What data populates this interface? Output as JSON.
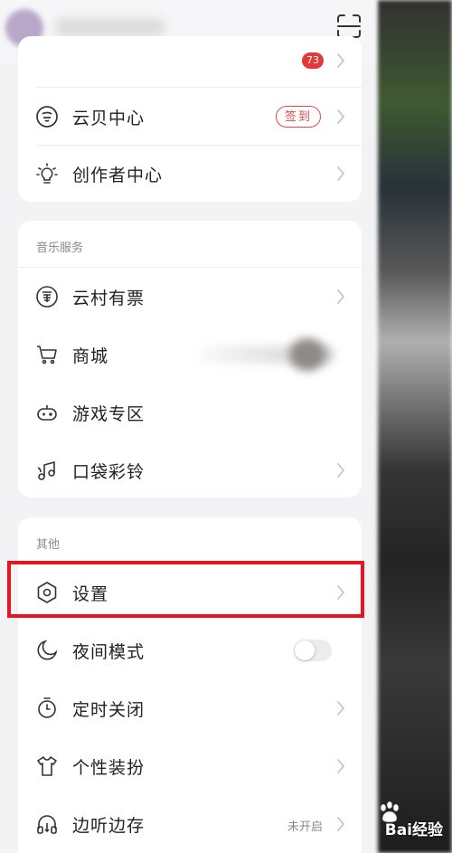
{
  "header": {
    "scan_icon": "scan-icon",
    "notification_count": "73"
  },
  "card_top": {
    "items": [
      {
        "label": "云贝中心",
        "icon": "cloud-coin-icon",
        "action_label": "签到"
      },
      {
        "label": "创作者中心",
        "icon": "lightbulb-icon"
      }
    ]
  },
  "music_services": {
    "title": "音乐服务",
    "items": [
      {
        "label": "云村有票",
        "icon": "ticket-icon"
      },
      {
        "label": "商城",
        "icon": "cart-icon"
      },
      {
        "label": "游戏专区",
        "icon": "gamepad-icon"
      },
      {
        "label": "口袋彩铃",
        "icon": "ringtone-icon"
      }
    ]
  },
  "other": {
    "title": "其他",
    "items": [
      {
        "label": "设置",
        "icon": "settings-icon"
      },
      {
        "label": "夜间模式",
        "icon": "moon-icon",
        "toggle_on": false
      },
      {
        "label": "定时关闭",
        "icon": "timer-icon"
      },
      {
        "label": "个性装扮",
        "icon": "shirt-icon"
      },
      {
        "label": "边听边存",
        "icon": "headphone-icon",
        "status": "未开启"
      }
    ]
  },
  "highlight_color": "#e8141f",
  "accent_color": "#e34a4a",
  "watermark": {
    "text": "Bai经验",
    "icon": "paw-icon"
  }
}
